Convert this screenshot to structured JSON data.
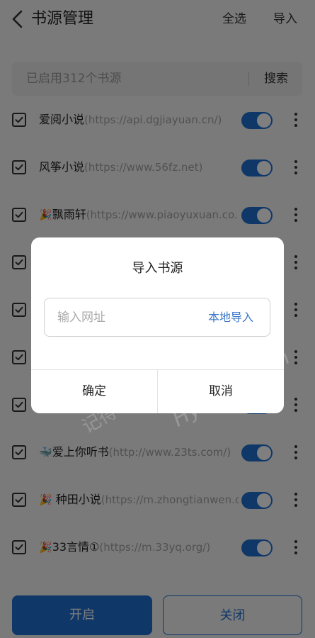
{
  "header": {
    "title": "书源管理",
    "select_all": "全选",
    "import": "导入"
  },
  "search": {
    "placeholder": "已启用312个书源",
    "button": "搜索"
  },
  "sources": [
    {
      "emoji": "",
      "name": "爱阅小说",
      "url": "(https://api.dgjiayuan.cn/)",
      "enabled": true,
      "checked": true
    },
    {
      "emoji": "",
      "name": "风筝小说",
      "url": "(https://www.56fz.net)",
      "enabled": true,
      "checked": true
    },
    {
      "emoji": "🎉",
      "name": "飘雨轩",
      "url": "(https://www.piaoyuxuan.co...",
      "enabled": true,
      "checked": true
    },
    {
      "emoji": "",
      "name": "",
      "url": "",
      "enabled": true,
      "checked": true
    },
    {
      "emoji": "",
      "name": "",
      "url": "",
      "enabled": true,
      "checked": true
    },
    {
      "emoji": "",
      "name": "",
      "url": "",
      "enabled": true,
      "checked": true
    },
    {
      "emoji": "",
      "name": "",
      "url": "",
      "enabled": true,
      "checked": true
    },
    {
      "emoji": "🐳",
      "name": "爱上你听书",
      "url": "(http://www.23ts.com/)",
      "enabled": true,
      "checked": true
    },
    {
      "emoji": "🎉",
      "name": " 种田小说",
      "url": "(https://m.zhongtianwen.cn)",
      "enabled": true,
      "checked": true
    },
    {
      "emoji": "🎉",
      "name": "33言情①",
      "url": "(https://m.33yq.org/)",
      "enabled": true,
      "checked": true
    }
  ],
  "footer": {
    "enable": "开启",
    "disable": "关闭"
  },
  "dialog": {
    "title": "导入书源",
    "url_placeholder": "输入网址",
    "local_import": "本地导入",
    "confirm": "确定",
    "cancel": "取消"
  },
  "watermark": {
    "text": "记得收藏:黑域基地",
    "brand": "Hybase.com"
  },
  "colors": {
    "accent": "#1e6fd0",
    "link": "#3c78c8",
    "overlay": "rgba(0,0,0,0.5)"
  }
}
